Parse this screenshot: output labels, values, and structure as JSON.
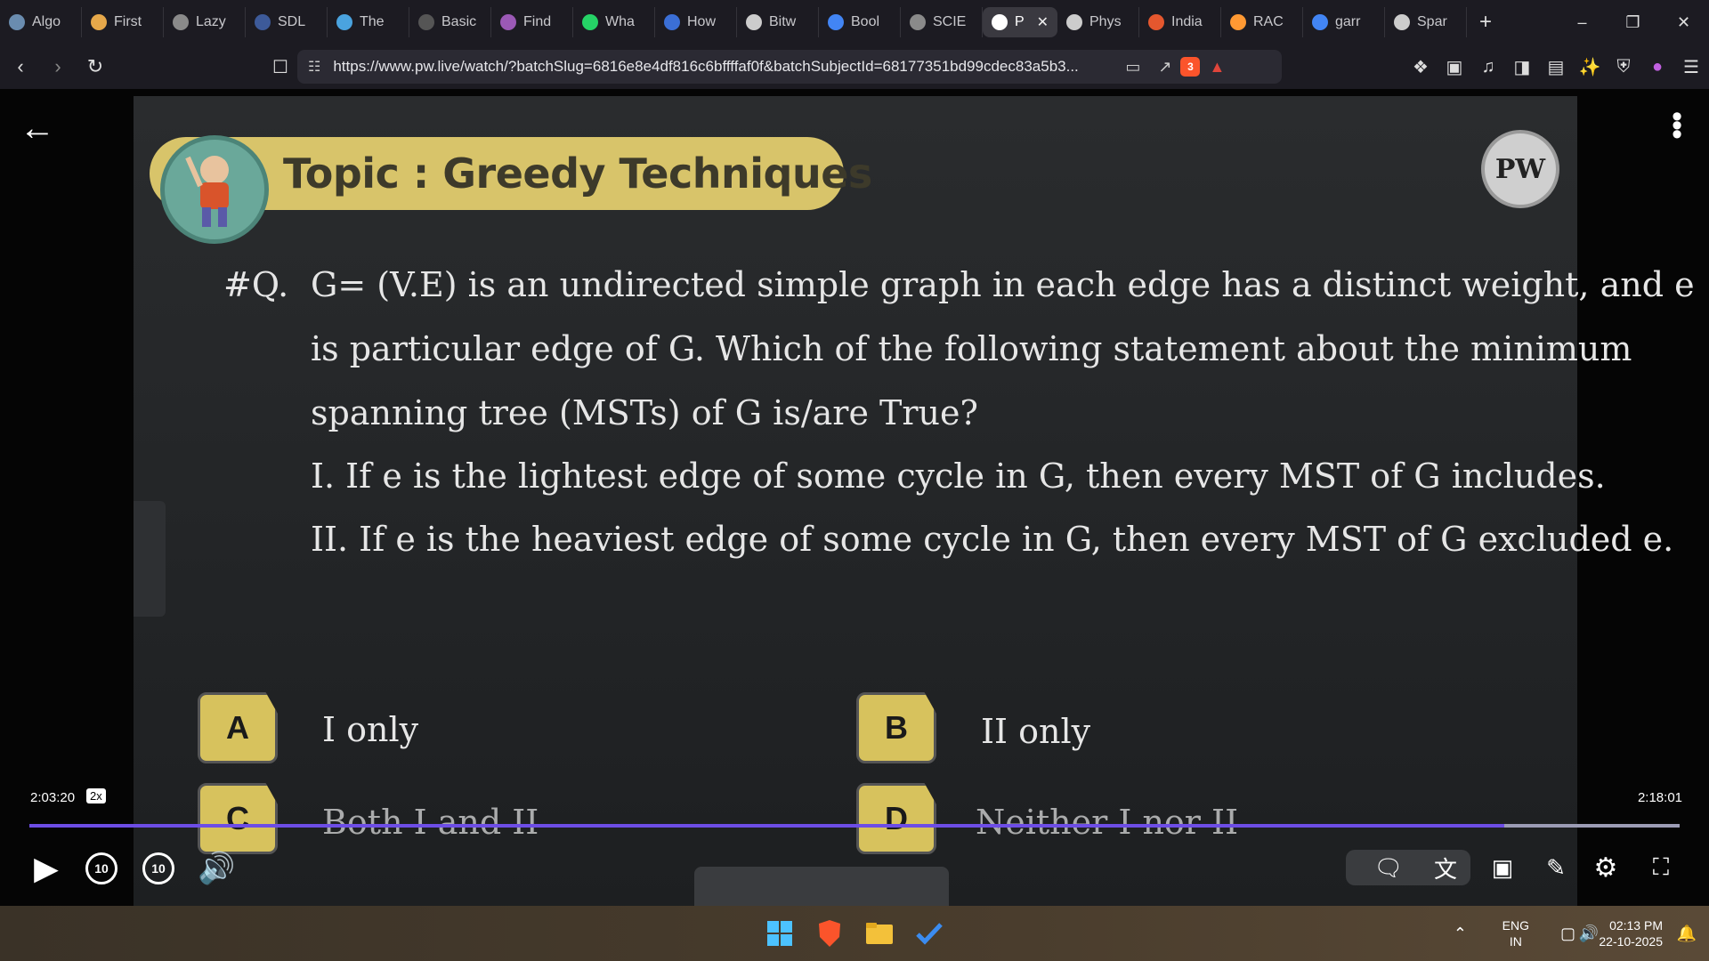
{
  "browser": {
    "tabs": [
      {
        "label": "Algo",
        "icon": "page-icon",
        "color": "#6a8caf"
      },
      {
        "label": "First",
        "icon": "bolt-icon",
        "color": "#e6a84a"
      },
      {
        "label": "Lazy",
        "icon": "globe-icon",
        "color": "#8a8a8a"
      },
      {
        "label": "SDL",
        "icon": "logo-icon",
        "color": "#3d5a99"
      },
      {
        "label": "The",
        "icon": "code-icon",
        "color": "#4aa3df"
      },
      {
        "label": "Basic",
        "icon": "page-icon",
        "color": "#555"
      },
      {
        "label": "Find",
        "icon": "brain-icon",
        "color": "#9b59b6"
      },
      {
        "label": "Wha",
        "icon": "whatsapp-icon",
        "color": "#25d366"
      },
      {
        "label": "How",
        "icon": "bookmark-icon",
        "color": "#3b6fd6"
      },
      {
        "label": "Bitw",
        "icon": "text-icon",
        "color": "#ccc"
      },
      {
        "label": "Bool",
        "icon": "google-icon",
        "color": "#4285f4"
      },
      {
        "label": "SCIE",
        "icon": "globe-icon",
        "color": "#8a8a8a"
      },
      {
        "label": "P",
        "icon": "speaker-icon",
        "color": "#fff",
        "active": true
      },
      {
        "label": "Phys",
        "icon": "wiki-icon",
        "color": "#ccc"
      },
      {
        "label": "India",
        "icon": "burger-icon",
        "color": "#e4572e"
      },
      {
        "label": "RAC",
        "icon": "flag-icon",
        "color": "#ff9933"
      },
      {
        "label": "garr",
        "icon": "google-icon",
        "color": "#4285f4"
      },
      {
        "label": "Spar",
        "icon": "openai-icon",
        "color": "#ccc"
      }
    ],
    "new_tab": "+",
    "url": "https://www.pw.live/watch/?batchSlug=6816e8e4df816c6bffffaf0f&batchSubjectId=68177351bd99cdec83a5b3...",
    "shield_count": "3"
  },
  "slide": {
    "topic": "Topic : Greedy Techniques",
    "logo": "PW",
    "q_num": "#Q.",
    "q_line1": "G= (V.E) is an undirected simple graph in each edge has a distinct weight, and e",
    "q_line2": "is particular edge of G. Which of the following statement about the minimum",
    "q_line3": "spanning tree (MSTs) of G is/are True?",
    "stmt1": "I.  If e is the lightest edge of some cycle in G, then every MST of G includes.",
    "stmt2": "II.  If e is the heaviest edge of some cycle in G, then every MST of G excluded e.",
    "options": [
      {
        "letter": "A",
        "text": "I only"
      },
      {
        "letter": "B",
        "text": "II only"
      },
      {
        "letter": "C",
        "text": "Both I and II"
      },
      {
        "letter": "D",
        "text": "Neither I nor II"
      }
    ]
  },
  "player": {
    "current_time": "2:03:20",
    "speed": "2x",
    "total_time": "2:18:01",
    "progress": 0.894,
    "skip_back": "10",
    "skip_fwd": "10",
    "accent": "#6d4de6"
  },
  "taskbar": {
    "lang1": "ENG",
    "lang2": "IN",
    "time": "02:13 PM",
    "date": "22-10-2025"
  }
}
